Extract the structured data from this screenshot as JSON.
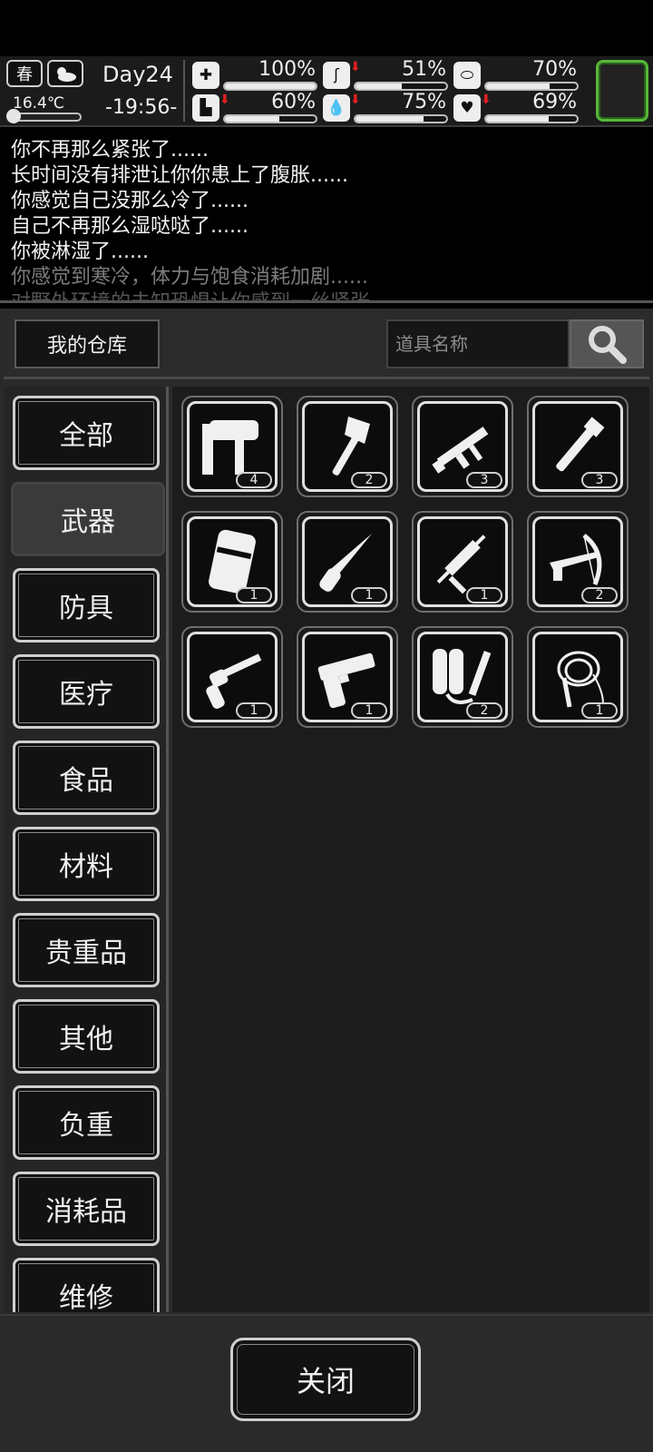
{
  "hud": {
    "season": "春",
    "weather_icon": "cloudy-sun-icon",
    "temperature": "16.4℃",
    "temperature_level": 0.1,
    "day": "Day24",
    "time": "-19:56-",
    "stats": [
      {
        "name": "health",
        "icon": "medkit-icon",
        "value": "100%",
        "level": 1.0,
        "falling": false
      },
      {
        "name": "hunger",
        "icon": "stomach-icon",
        "value": "51%",
        "level": 0.51,
        "falling": true
      },
      {
        "name": "sanity",
        "icon": "pill-icon",
        "value": "70%",
        "level": 0.7,
        "falling": false
      },
      {
        "name": "stamina",
        "icon": "boot-icon",
        "value": "60%",
        "level": 0.6,
        "falling": true
      },
      {
        "name": "thirst",
        "icon": "water-drop-icon",
        "value": "75%",
        "level": 0.75,
        "falling": true
      },
      {
        "name": "mood",
        "icon": "heart-icon",
        "value": "69%",
        "level": 0.69,
        "falling": true
      }
    ]
  },
  "log": {
    "lines": [
      {
        "text": "你不再那么紧张了......",
        "style": "normal"
      },
      {
        "text": "长时间没有排泄让你你患上了腹胀......",
        "style": "normal"
      },
      {
        "text": "你感觉自己没那么冷了......",
        "style": "normal"
      },
      {
        "text": "自己不再那么湿哒哒了......",
        "style": "normal"
      },
      {
        "text": "你被淋湿了......",
        "style": "normal"
      },
      {
        "text": "你感觉到寒冷，体力与饱食消耗加剧......",
        "style": "dim"
      },
      {
        "text": "对野外环境的未知恐惧让你感到一丝紧张",
        "style": "dimmer"
      }
    ]
  },
  "warehouse": {
    "title": "我的仓库",
    "search_placeholder": "道具名称"
  },
  "categories": [
    {
      "label": "全部",
      "active": false
    },
    {
      "label": "武器",
      "active": true
    },
    {
      "label": "防具",
      "active": false
    },
    {
      "label": "医疗",
      "active": false
    },
    {
      "label": "食品",
      "active": false
    },
    {
      "label": "材料",
      "active": false
    },
    {
      "label": "贵重品",
      "active": false
    },
    {
      "label": "其他",
      "active": false
    },
    {
      "label": "负重",
      "active": false
    },
    {
      "label": "消耗品",
      "active": false
    },
    {
      "label": "维修",
      "active": false
    }
  ],
  "items": [
    {
      "icon": "nail-gun-icon",
      "count": "4"
    },
    {
      "icon": "axe-icon",
      "count": "2"
    },
    {
      "icon": "submachine-gun-icon",
      "count": "3"
    },
    {
      "icon": "pipe-wrench-icon",
      "count": "3"
    },
    {
      "icon": "riot-shield-icon",
      "count": "1"
    },
    {
      "icon": "knife-icon",
      "count": "1"
    },
    {
      "icon": "caulking-gun-icon",
      "count": "1"
    },
    {
      "icon": "crossbow-icon",
      "count": "2"
    },
    {
      "icon": "revolver-icon",
      "count": "1"
    },
    {
      "icon": "pistol-icon",
      "count": "1"
    },
    {
      "icon": "flamethrower-icon",
      "count": "2"
    },
    {
      "icon": "whip-icon",
      "count": "1"
    }
  ],
  "footer": {
    "close_label": "关闭"
  },
  "colors": {
    "avatar_border": "#57b83a",
    "falling_arrow": "#e02020"
  }
}
